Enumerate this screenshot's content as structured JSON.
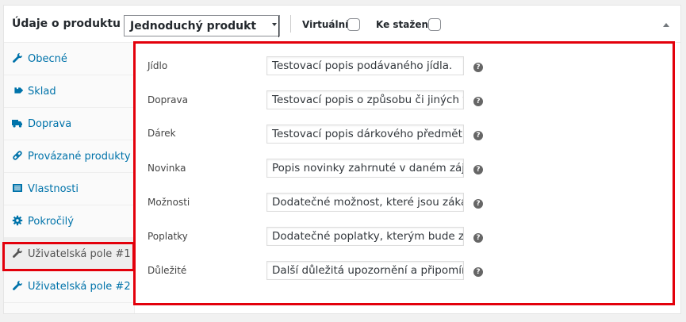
{
  "header": {
    "title": "Údaje o produktu —",
    "product_type": "Jednoduchý produkt",
    "virtual_label": "Virtuální:",
    "download_label": "Ke stažení:"
  },
  "sidebar": {
    "items": [
      {
        "label": "Obecné",
        "icon": "wrench-icon"
      },
      {
        "label": "Sklad",
        "icon": "tag-icon"
      },
      {
        "label": "Doprava",
        "icon": "truck-icon"
      },
      {
        "label": "Provázané produkty",
        "icon": "link-icon"
      },
      {
        "label": "Vlastnosti",
        "icon": "list-icon"
      },
      {
        "label": "Pokročilý",
        "icon": "gear-icon"
      },
      {
        "label": "Uživatelská pole #1",
        "icon": "wrench-icon"
      },
      {
        "label": "Uživatelská pole #2",
        "icon": "wrench-icon"
      }
    ],
    "active_index": 6
  },
  "fields": [
    {
      "label": "Jídlo",
      "value": "Testovací popis podávaného jídla."
    },
    {
      "label": "Doprava",
      "value": "Testovací popis o způsobu či jiných vla"
    },
    {
      "label": "Dárek",
      "value": "Testovací popis dárkového předmětu p"
    },
    {
      "label": "Novinka",
      "value": "Popis novinky zahrnuté v daném zájez"
    },
    {
      "label": "Možnosti",
      "value": "Dodatečné možnost, které jsou zákazi"
    },
    {
      "label": "Poplatky",
      "value": "Dodatečné poplatky, kterým bude zák"
    },
    {
      "label": "Důležité",
      "value": "Další důležitá upozornění a připomínk"
    }
  ],
  "help_glyph": "?",
  "colors": {
    "link": "#0073aa",
    "highlight": "#e3000b",
    "sidebar_bg": "#fafafa"
  }
}
